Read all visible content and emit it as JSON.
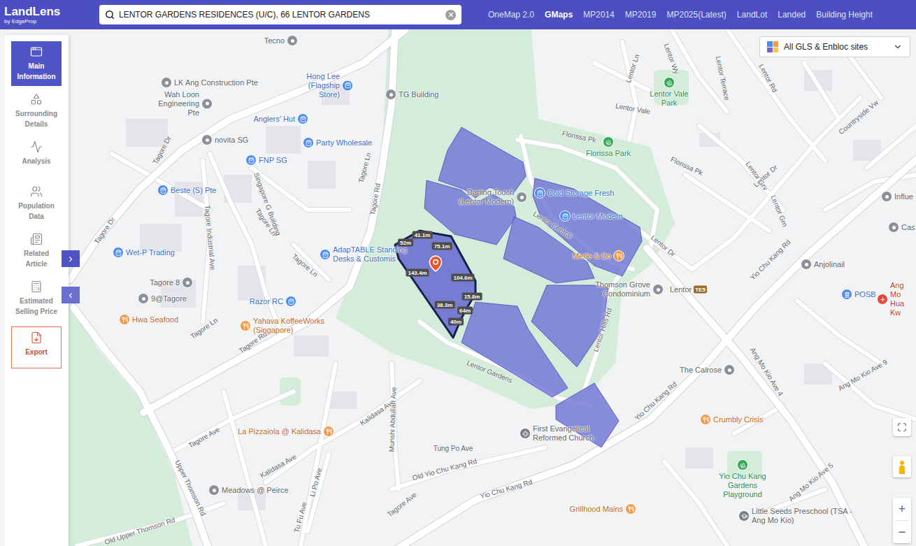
{
  "app": {
    "logo": "LandLens",
    "tagline": "by EdgeProp"
  },
  "search": {
    "value": "LENTOR GARDENS RESIDENCES (U/C), 66 LENTOR GARDENS"
  },
  "nav_tabs": [
    {
      "label": "OneMap 2.0",
      "selected": false
    },
    {
      "label": "GMaps",
      "selected": true
    },
    {
      "label": "MP2014",
      "selected": false
    },
    {
      "label": "MP2019",
      "selected": false
    },
    {
      "label": "MP2025(Latest)",
      "selected": false
    },
    {
      "label": "LandLot",
      "selected": false
    },
    {
      "label": "Landed",
      "selected": false
    },
    {
      "label": "Building Height",
      "selected": false
    }
  ],
  "sidebar": {
    "items": [
      {
        "label": "Main Information",
        "kind": "info",
        "selected": true
      },
      {
        "label": "Surrounding Details",
        "kind": "surroundings",
        "selected": false
      },
      {
        "label": "Analysis",
        "kind": "analysis",
        "selected": false
      },
      {
        "label": "Population Data",
        "kind": "population",
        "selected": false
      },
      {
        "label": "Related Article",
        "kind": "article",
        "selected": false
      },
      {
        "label": "Estimated Selling Price",
        "kind": "price",
        "selected": false
      },
      {
        "label": "Export",
        "kind": "export",
        "selected": false
      }
    ]
  },
  "panel_toggles": [
    "›",
    "‹"
  ],
  "layer_filter": {
    "label": "All GLS & Enbloc sites"
  },
  "map": {
    "places": [
      {
        "name": "Tecno",
        "kind": "place"
      },
      {
        "name": "LK Ang Construction Pte",
        "kind": "place"
      },
      {
        "name": "Hong Lee (Flagship Store)",
        "kind": "shop"
      },
      {
        "name": "TG Building",
        "kind": "place"
      },
      {
        "name": "Wah Loon Engineering Pte",
        "kind": "place"
      },
      {
        "name": "Anglers' Hut",
        "kind": "shop"
      },
      {
        "name": "Party Wholesale",
        "kind": "shop"
      },
      {
        "name": "novita SG",
        "kind": "place"
      },
      {
        "name": "FNP SG",
        "kind": "shop"
      },
      {
        "name": "Beste (S) Pte",
        "kind": "shop"
      },
      {
        "name": "Wet-P Trading",
        "kind": "shop"
      },
      {
        "name": "AdapTABLE Standing Desks & Customis",
        "kind": "shop"
      },
      {
        "name": "Tagore 8",
        "kind": "place"
      },
      {
        "name": "9@Tagore",
        "kind": "place"
      },
      {
        "name": "Razor RC",
        "kind": "shop"
      },
      {
        "name": "Hwa Seafood",
        "kind": "food"
      },
      {
        "name": "Yahava KoffeeWorks (Singapore)",
        "kind": "food"
      },
      {
        "name": "Darling Touch (Lentor Modern)",
        "kind": "place"
      },
      {
        "name": "Cold Storage Fresh",
        "kind": "shop"
      },
      {
        "name": "Lentor Modern",
        "kind": "shop"
      },
      {
        "name": "Merle & Co",
        "kind": "food"
      },
      {
        "name": "Thomson Grove Condominium",
        "kind": "place"
      },
      {
        "name": "The Calrose",
        "kind": "place"
      },
      {
        "name": "Anjolinail",
        "kind": "place"
      },
      {
        "name": "POSB",
        "kind": "bank"
      },
      {
        "name": "Ang Mo Hua Kw",
        "kind": "hospital"
      },
      {
        "name": "Influe",
        "kind": "place"
      },
      {
        "name": "Cas",
        "kind": "place"
      },
      {
        "name": "First Evangelical Reformed Church",
        "kind": "worship"
      },
      {
        "name": "Crumbly Crisis",
        "kind": "food"
      },
      {
        "name": "Yio Chu Kang Gardens Playground",
        "kind": "park"
      },
      {
        "name": "Little Seeds Preschool (TSA - Ang Mo Kio)",
        "kind": "school"
      },
      {
        "name": "Grillhood Mains",
        "kind": "food"
      },
      {
        "name": "La Pizzaiola @ Kalidasa",
        "kind": "food"
      },
      {
        "name": "Meadows @ Peirce",
        "kind": "place"
      },
      {
        "name": "Lentor Vale Park",
        "kind": "park"
      },
      {
        "name": "Florissa Park",
        "kind": "park"
      }
    ],
    "station": {
      "name": "Lentor",
      "code": "TE5"
    },
    "roads": [
      "Tagore Dr",
      "Tagore Dr",
      "Tagore Ln",
      "Tagore Ln",
      "Tagore Ln",
      "Tagore Ln",
      "Tagore Rd",
      "Tagore Rd",
      "Tagore Industrial Ave",
      "Singapore G Building",
      "Lentor Central",
      "Lentor Gardens",
      "Lentor Hills Rd",
      "Lentor Dr",
      "Lentor Dr",
      "Lentor Rd",
      "Lentor Ln",
      "Lentor Vale",
      "Lentor Wy",
      "Lentor Terrace",
      "Lentor Grv",
      "Lentor Grn",
      "Florissa Pk",
      "Florissa Pk",
      "Countryside Vw",
      "Yio Chu Kang Rd",
      "Yio Chu Kang Rd",
      "Yio Chu Kang Rd",
      "Ang Mo Kio Ave 4",
      "Ang Mo Kio Ave 9",
      "Ang Mo Kio Ave 5",
      "Kalidasa Ave",
      "Kalidasa Ave",
      "Munshi Abdullah Ave",
      "Tagore Ave",
      "Tagore Ave",
      "Li Po Ave",
      "Tu Fu Ave",
      "Tung Po Ave",
      "Old Yio Chu Kang Rd",
      "Upper Thomson Rd",
      "Old Upper Thomson Rd"
    ],
    "measurements": [
      "41.1m",
      "52m",
      "75.1m",
      "143.4m",
      "104.6m",
      "15.8m",
      "38.3m",
      "64m",
      "40m"
    ],
    "parcels": [
      {
        "selected": false
      },
      {
        "selected": false
      },
      {
        "selected": false
      },
      {
        "selected": false
      },
      {
        "selected": false
      },
      {
        "selected": true
      },
      {
        "selected": false
      },
      {
        "selected": false
      }
    ]
  },
  "zoom": [
    "+",
    "−"
  ]
}
